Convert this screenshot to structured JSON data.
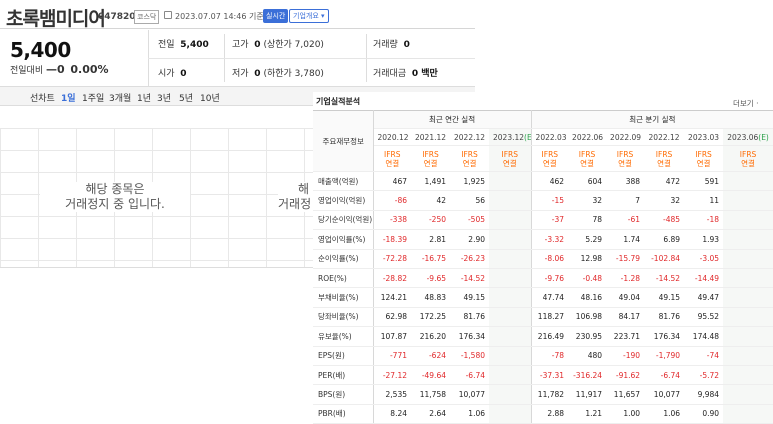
{
  "header": {
    "name": "초록뱀미디어",
    "code": "047820",
    "market": "코스닥",
    "datetime": "2023.07.07 14:46",
    "basis": "기준(장중)",
    "realtime_badge": "실시간",
    "overview_button": "기업개요 ▾"
  },
  "summary": {
    "price": "5,400",
    "change_label": "전일대비",
    "change_arrow": "—",
    "change_value": "0",
    "change_rate": "0.00%",
    "prev_label": "전일",
    "prev_value": "5,400",
    "high_label": "고가",
    "high_value": "0",
    "high_note": "(상한가 7,020)",
    "volume_label": "거래량",
    "volume_value": "0",
    "open_label": "시가",
    "open_value": "0",
    "low_label": "저가",
    "low_value": "0",
    "low_note": "(하한가 3,780)",
    "amount_label": "거래대금",
    "amount_value": "0 백만"
  },
  "periods": {
    "line_label": "선차트",
    "p1": "1일",
    "p2": "1주일",
    "p3": "3개월",
    "p4": "1년",
    "p5": "3년",
    "p6": "5년",
    "p7": "10년"
  },
  "chart": {
    "halt_line1": "해당 종목은",
    "halt_line2": "거래정지 중 입니다.",
    "halt_partial1": "해",
    "halt_partial2": "거래정"
  },
  "financials": {
    "title": "기업실적분석",
    "more": "더보기 ·",
    "item_header": "주요재무정보",
    "annual_header": "최근 연간 실적",
    "quarter_header": "최근 분기 실적",
    "years": [
      "2020.12",
      "2021.12",
      "2022.12",
      "2023.12(E)",
      "2022.03",
      "2022.06",
      "2022.09",
      "2022.12",
      "2023.03",
      "2023.06(E)"
    ],
    "ifrs_top": "IFRS",
    "ifrs_bottom": "연결",
    "rows": [
      {
        "label": "매출액(억원)",
        "values": [
          "467",
          "1,491",
          "1,925",
          "",
          "462",
          "604",
          "388",
          "472",
          "591",
          ""
        ]
      },
      {
        "label": "영업이익(억원)",
        "values": [
          "-86",
          "42",
          "56",
          "",
          "-15",
          "32",
          "7",
          "32",
          "11",
          ""
        ]
      },
      {
        "label": "당기순이익(억원)",
        "values": [
          "-338",
          "-250",
          "-505",
          "",
          "-37",
          "78",
          "-61",
          "-485",
          "-18",
          ""
        ]
      },
      {
        "label": "영업이익률(%)",
        "values": [
          "-18.39",
          "2.81",
          "2.90",
          "",
          "-3.32",
          "5.29",
          "1.74",
          "6.89",
          "1.93",
          ""
        ]
      },
      {
        "label": "순이익률(%)",
        "values": [
          "-72.28",
          "-16.75",
          "-26.23",
          "",
          "-8.06",
          "12.98",
          "-15.79",
          "-102.84",
          "-3.05",
          ""
        ]
      },
      {
        "label": "ROE(%)",
        "values": [
          "-28.82",
          "-9.65",
          "-14.52",
          "",
          "-9.76",
          "-0.48",
          "-1.28",
          "-14.52",
          "-14.49",
          ""
        ]
      },
      {
        "label": "부채비율(%)",
        "values": [
          "124.21",
          "48.83",
          "49.15",
          "",
          "47.74",
          "48.16",
          "49.04",
          "49.15",
          "49.47",
          ""
        ]
      },
      {
        "label": "당좌비율(%)",
        "values": [
          "62.98",
          "172.25",
          "81.76",
          "",
          "118.27",
          "106.98",
          "84.17",
          "81.76",
          "95.52",
          ""
        ]
      },
      {
        "label": "유보율(%)",
        "values": [
          "107.87",
          "216.20",
          "176.34",
          "",
          "216.49",
          "230.95",
          "223.71",
          "176.34",
          "174.48",
          ""
        ]
      },
      {
        "label": "EPS(원)",
        "values": [
          "-771",
          "-624",
          "-1,580",
          "",
          "-78",
          "480",
          "-190",
          "-1,790",
          "-74",
          ""
        ]
      },
      {
        "label": "PER(배)",
        "values": [
          "-27.12",
          "-49.64",
          "-6.74",
          "",
          "-37.31",
          "-316.24",
          "-91.62",
          "-6.74",
          "-5.72",
          ""
        ]
      },
      {
        "label": "BPS(원)",
        "values": [
          "2,535",
          "11,758",
          "10,077",
          "",
          "11,782",
          "11,917",
          "11,657",
          "10,077",
          "9,984",
          ""
        ]
      },
      {
        "label": "PBR(배)",
        "values": [
          "8.24",
          "2.64",
          "1.06",
          "",
          "2.88",
          "1.21",
          "1.00",
          "1.06",
          "0.90",
          ""
        ]
      }
    ]
  }
}
